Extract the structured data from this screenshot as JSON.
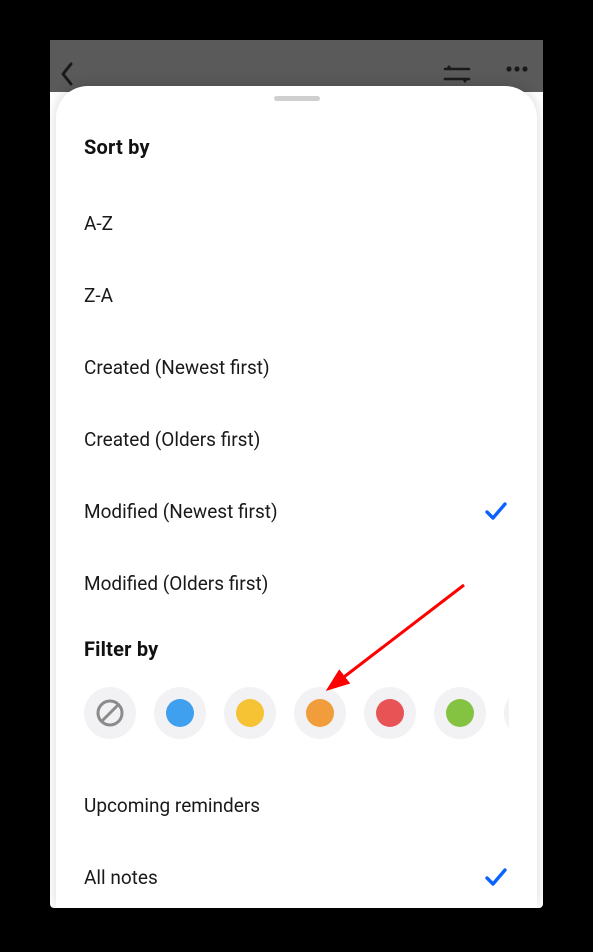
{
  "sort": {
    "title": "Sort by",
    "options": {
      "az": "A-Z",
      "za": "Z-A",
      "created_new": "Created (Newest first)",
      "created_old": "Created (Olders first)",
      "modified_new": "Modified (Newest first)",
      "modified_old": "Modified (Olders first)"
    },
    "selected": "modified_new"
  },
  "filter": {
    "title": "Filter by",
    "colors": {
      "none": "none",
      "blue": "#3ea0ef",
      "yellow": "#f6c335",
      "orange": "#f19d3b",
      "red": "#e85455",
      "green": "#84c241",
      "purple": "#b894e3"
    },
    "upcoming": "Upcoming reminders",
    "all": "All notes",
    "selected": "all"
  },
  "accent_check": "#0a63ff"
}
